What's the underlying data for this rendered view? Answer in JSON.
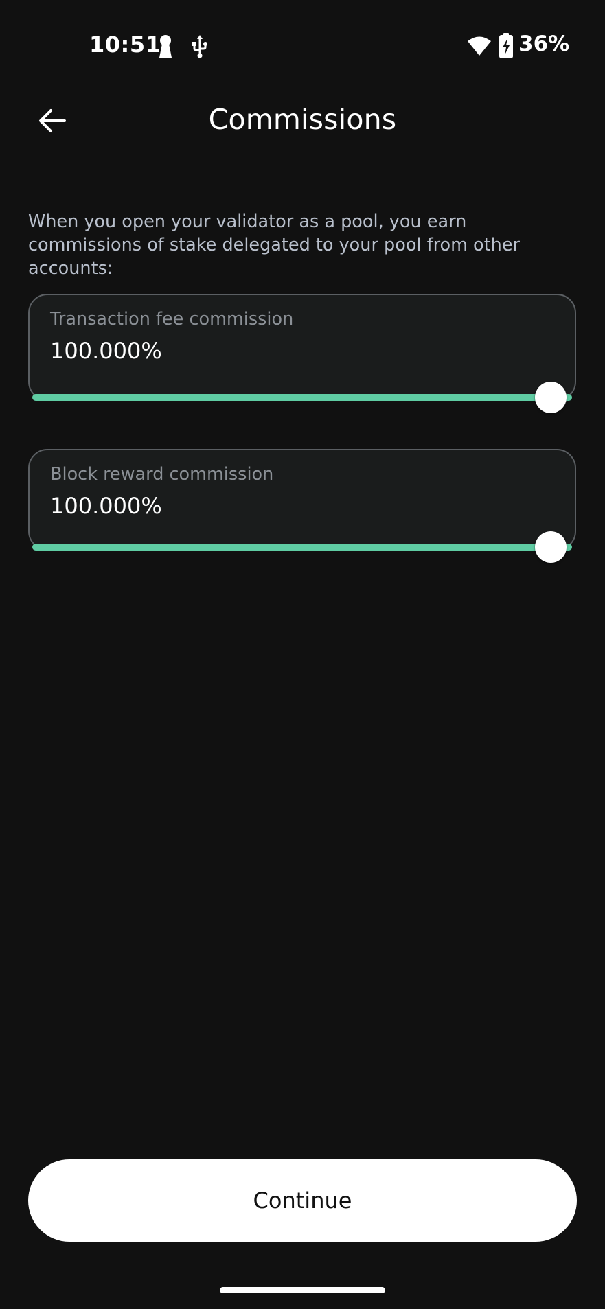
{
  "status_bar": {
    "time": "10:51",
    "battery": "36%",
    "icons": [
      "keyhole-icon",
      "usb-icon",
      "wifi-icon",
      "battery-charging-icon"
    ]
  },
  "header": {
    "title": "Commissions",
    "back_icon": "arrow-left-icon"
  },
  "description": "When you open your validator as a pool, you earn commissions of stake delegated to your pool from other accounts:",
  "fields": [
    {
      "label": "Transaction fee commission",
      "value": "100.000%",
      "slider_level": 1.0
    },
    {
      "label": "Block reward commission",
      "value": "100.000%",
      "slider_level": 1.0
    }
  ],
  "continue_label": "Continue",
  "colors": {
    "background": "#111111",
    "accent": "#5fcca3",
    "field_background": "#1a1c1c",
    "field_border": "#5b5f63",
    "label": "#8b9096",
    "description": "#b9c0cc"
  }
}
